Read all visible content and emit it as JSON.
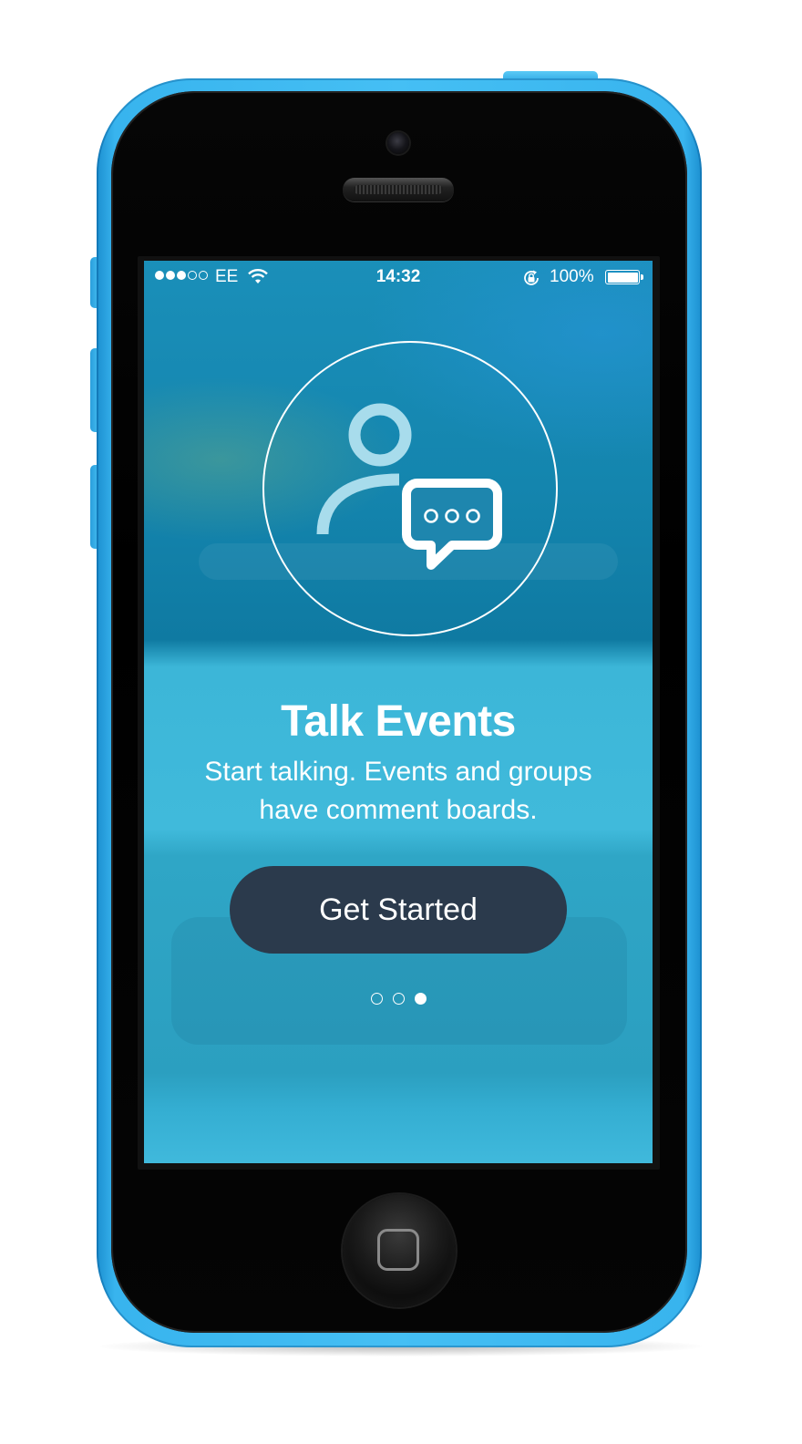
{
  "status_bar": {
    "signal_bars": [
      true,
      true,
      true,
      false,
      false
    ],
    "carrier": "EE",
    "time": "14:32",
    "battery": "100%",
    "battery_level": 1.0,
    "icons": [
      "wifi-icon",
      "rotation-lock-icon",
      "battery-icon"
    ]
  },
  "onboarding": {
    "icon": "person-chat-icon",
    "title": "Talk Events",
    "subtitle": "Start talking. Events and groups have comment boards.",
    "cta_label": "Get Started",
    "page_count": 3,
    "current_page": 3
  },
  "device": {
    "name": "iPhone 5c",
    "body_color": "#3fb8f0"
  },
  "colors": {
    "screen_background": "#3ab4d8",
    "button_background": "#2b3a4c",
    "text": "#ffffff"
  }
}
